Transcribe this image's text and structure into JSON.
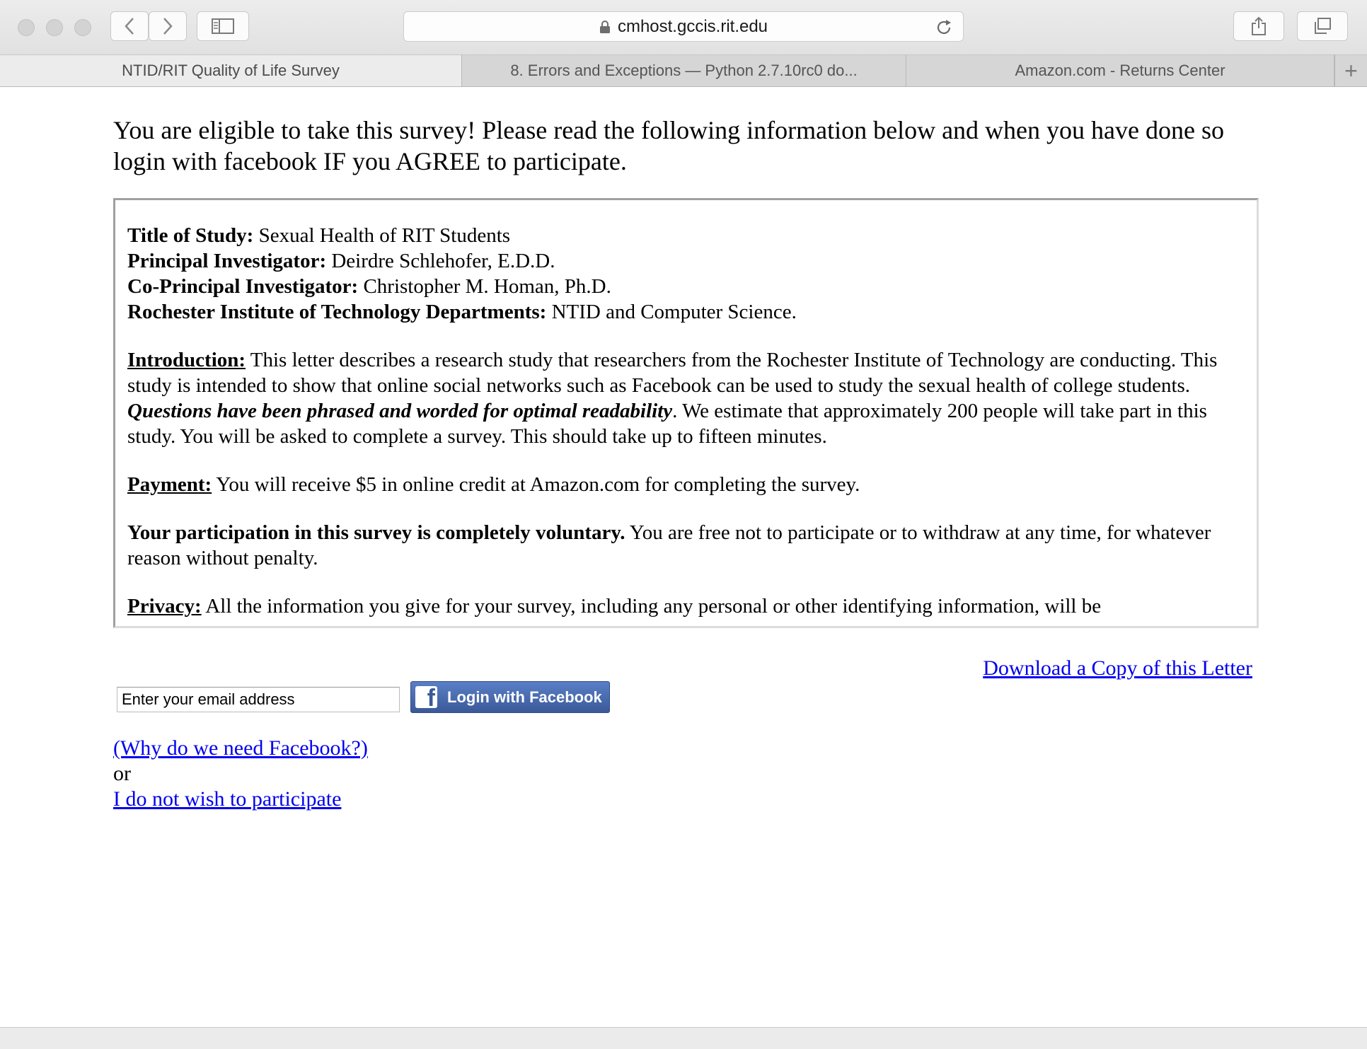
{
  "browser": {
    "url": "cmhost.gccis.rit.edu",
    "tabs": [
      {
        "label": "NTID/RIT Quality of Life Survey",
        "active": true
      },
      {
        "label": "8. Errors and Exceptions — Python 2.7.10rc0 do...",
        "active": false
      },
      {
        "label": "Amazon.com - Returns Center",
        "active": false
      }
    ],
    "new_tab_label": "+"
  },
  "page": {
    "eligible_text": "You are eligible to take this survey! Please read the following information below and when you have done so login with facebook IF you AGREE to participate.",
    "letter": {
      "title_label": "Title of Study:",
      "title_value": " Sexual Health of RIT Students",
      "pi_label": "Principal Investigator:",
      "pi_value": " Deirdre Schlehofer, E.D.D.",
      "copi_label": "Co-Principal Investigator:",
      "copi_value": " Christopher M. Homan, Ph.D.",
      "dept_label": "Rochester Institute of Technology Departments:",
      "dept_value": " NTID and Computer Science.",
      "intro_label": "Introduction:",
      "intro_text_1": " This letter describes a research study that researchers from the Rochester Institute of Technology are conducting. This study is intended to show that online social networks such as Facebook can be used to study the sexual health of college students. ",
      "intro_emphasis": "Questions have been phrased and worded for optimal readability",
      "intro_text_2": ". We estimate that approximately 200 people will take part in this study. You will be asked to complete a survey. This should take up to fifteen minutes.",
      "payment_label": "Payment:",
      "payment_text": " You will receive $5 in online credit at Amazon.com for completing the survey.",
      "voluntary_label": "Your participation in this survey is completely voluntary.",
      "voluntary_text": " You are free not to participate or to withdraw at any time, for whatever reason without penalty.",
      "privacy_label": "Privacy:",
      "privacy_text": " All the information you give for your survey, including any personal or other identifying information, will be"
    },
    "download_link": "Download a Copy of this Letter",
    "email_placeholder": "Enter your email address",
    "fb_login_label": "Login with Facebook",
    "why_facebook_link": "(Why do we need Facebook?)",
    "or_text": "or",
    "decline_link": "I do not wish to participate"
  }
}
